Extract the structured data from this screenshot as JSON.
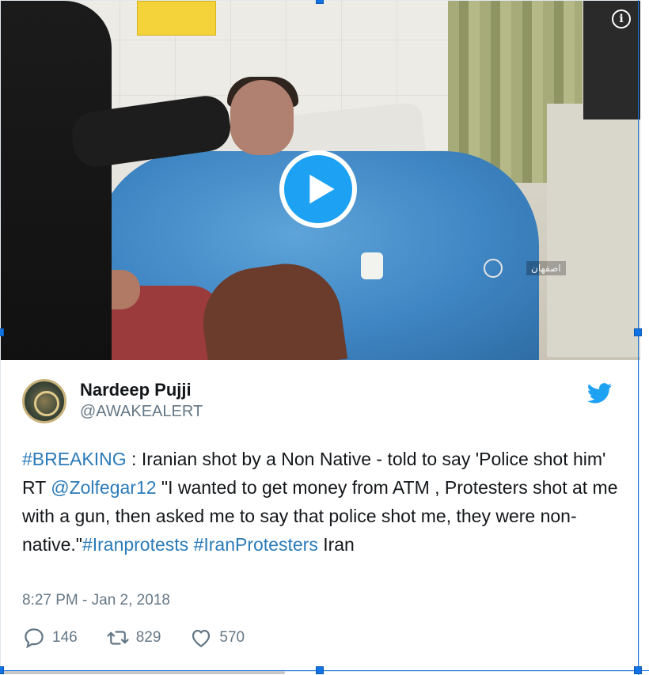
{
  "media": {
    "overlay_text": "اصفهان"
  },
  "author": {
    "name": "Nardeep Pujji",
    "handle": "@AWAKEALERT"
  },
  "tweet": {
    "seg1_link": "#BREAKING",
    "seg2": " : Iranian shot by a Non Native - told to say 'Police shot him'",
    "seg3": "RT ",
    "seg4_link": "@Zolfegar12",
    "seg5": " \"I wanted to get money from ATM , Protesters shot at me with a gun, then asked me to say that police shot me, they were non-native.\"",
    "seg6_link": "#Iranprotests",
    "seg7": " ",
    "seg8_link": "#IranProtesters",
    "seg9": " Iran"
  },
  "timestamp": "8:27 PM - Jan 2, 2018",
  "actions": {
    "replies": "146",
    "retweets": "829",
    "likes": "570"
  },
  "colors": {
    "accent": "#1da1f2",
    "link": "#2b7bb9",
    "muted": "#657786"
  },
  "icons": {
    "info": "info-icon",
    "play": "play-icon",
    "bird": "twitter-bird-icon",
    "reply": "reply-icon",
    "retweet": "retweet-icon",
    "like": "heart-icon"
  }
}
